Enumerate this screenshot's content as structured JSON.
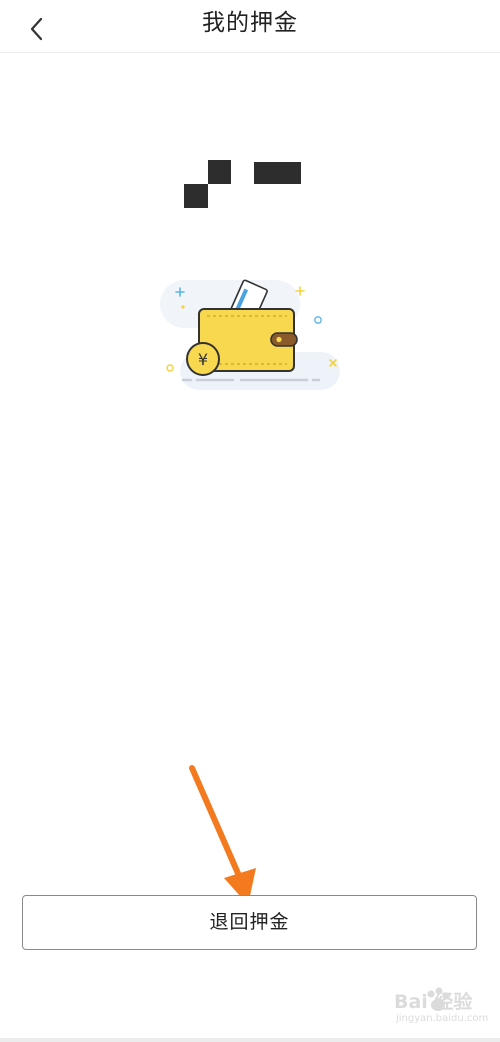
{
  "header": {
    "title": "我的押金",
    "back_icon": "chevron-left-icon"
  },
  "deposit": {
    "amount_redacted": true
  },
  "illustration": {
    "icon": "wallet-icon",
    "currency_symbol": "¥",
    "colors": {
      "wallet": "#f8d84e",
      "wallet_outline": "#333333",
      "strap": "#8b5a2b",
      "card": "#4aa3df",
      "sparkle_blue": "#5ab6e8",
      "sparkle_yellow": "#f5d23c"
    }
  },
  "actions": {
    "refund_label": "退回押金"
  },
  "annotation": {
    "arrow_color": "#f47a20"
  },
  "watermark": {
    "text": "Bai 经验",
    "subtext": "jingyan.baidu.com"
  }
}
